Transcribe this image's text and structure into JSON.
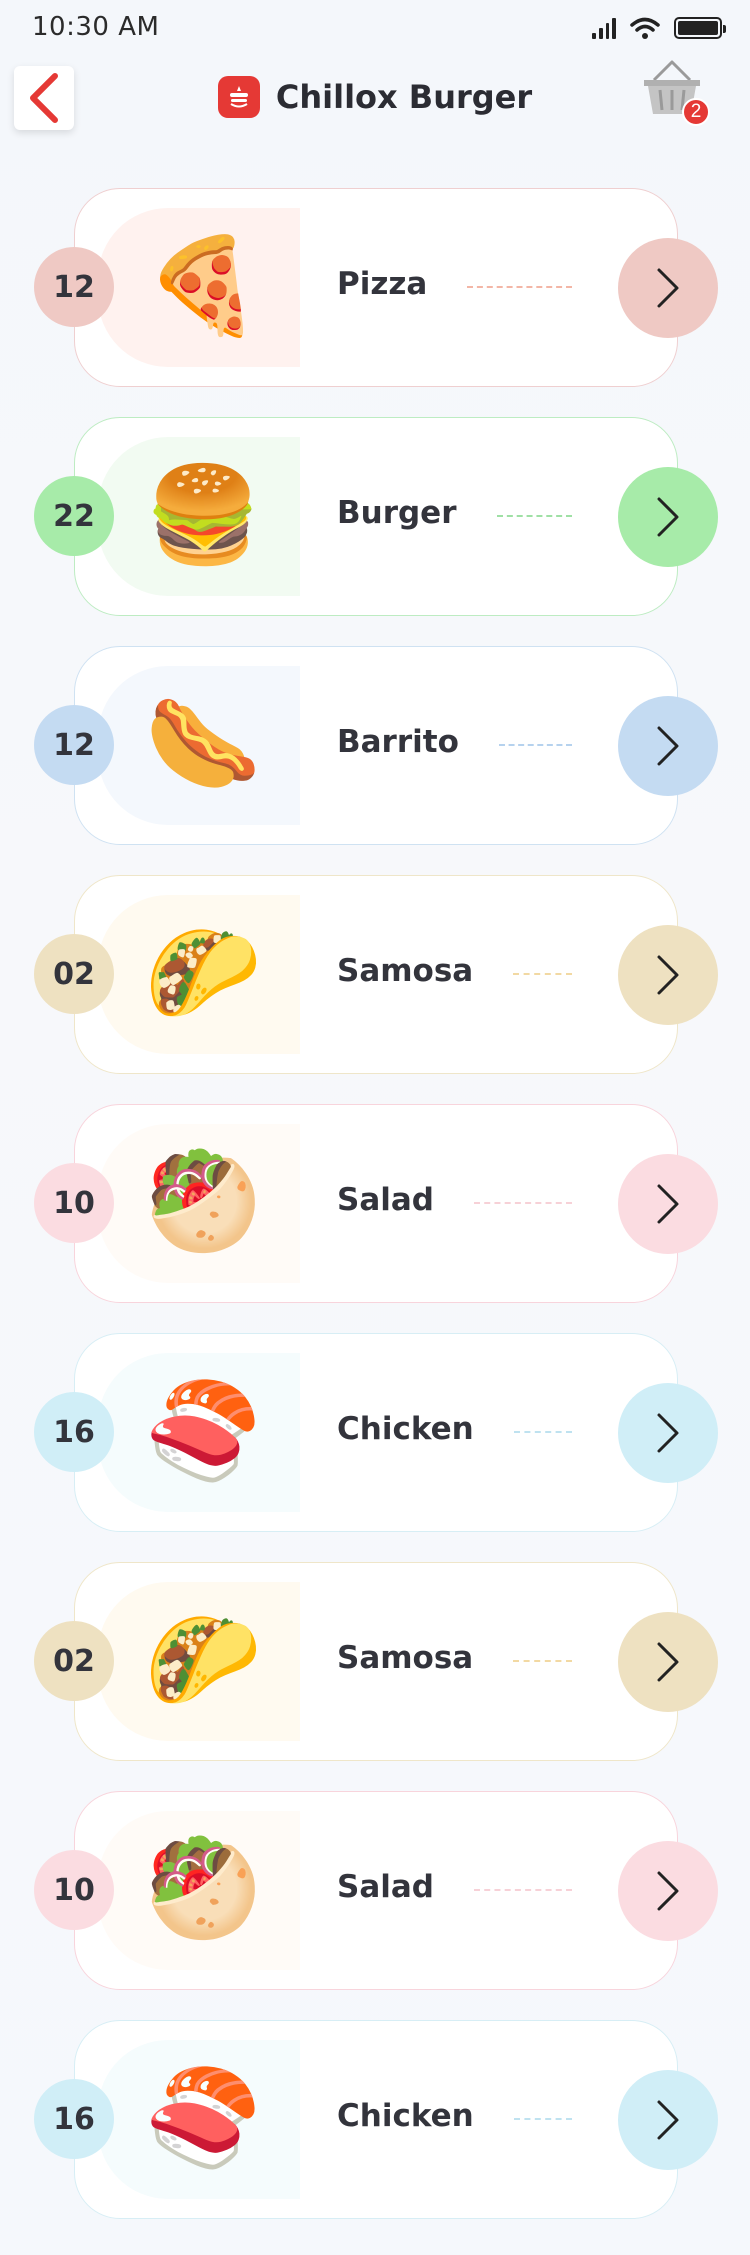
{
  "status_bar": {
    "time": "10:30 AM"
  },
  "header": {
    "title": "Chillox Burger",
    "cart_count": "2",
    "accent": "#e53935"
  },
  "categories": [
    {
      "count": "12",
      "name": "Pizza",
      "icon": "pizza-icon",
      "emoji": "🍕",
      "color": "#efc9c4",
      "tint": "#fff2ef",
      "border": "#efcfd0",
      "dash": "#f3b6a6"
    },
    {
      "count": "22",
      "name": "Burger",
      "icon": "burger-icon",
      "emoji": "🍔",
      "color": "#a7eba9",
      "tint": "#f2fbf2",
      "border": "#bdecc2",
      "dash": "#9fe0a5"
    },
    {
      "count": "12",
      "name": "Barrito",
      "icon": "hotdog-icon",
      "emoji": "🌭",
      "color": "#c4dbf2",
      "tint": "#f4f8fd",
      "border": "#cfe2f2",
      "dash": "#b6d2ee"
    },
    {
      "count": "02",
      "name": "Samosa",
      "icon": "taco-icon",
      "emoji": "🌮",
      "color": "#eee1c1",
      "tint": "#fffaf0",
      "border": "#efe6c9",
      "dash": "#f2d9a3"
    },
    {
      "count": "10",
      "name": "Salad",
      "icon": "pita-icon",
      "emoji": "🥙",
      "color": "#fbdce1",
      "tint": "#fffbf7",
      "border": "#f8d4dc",
      "dash": "#f7d1d7"
    },
    {
      "count": "16",
      "name": "Chicken",
      "icon": "sushi-icon",
      "emoji": "🍣",
      "color": "#d0eef7",
      "tint": "#f5fcfd",
      "border": "#d7eef5",
      "dash": "#bfe2f0"
    },
    {
      "count": "02",
      "name": "Samosa",
      "icon": "taco-icon",
      "emoji": "🌮",
      "color": "#eee1c1",
      "tint": "#fffaf0",
      "border": "#efe6c9",
      "dash": "#f2d9a3"
    },
    {
      "count": "10",
      "name": "Salad",
      "icon": "pita-icon",
      "emoji": "🥙",
      "color": "#fbdce1",
      "tint": "#fffbf7",
      "border": "#f8d4dc",
      "dash": "#f7d1d7"
    },
    {
      "count": "16",
      "name": "Chicken",
      "icon": "sushi-icon",
      "emoji": "🍣",
      "color": "#d0eef7",
      "tint": "#f5fcfd",
      "border": "#d7eef5",
      "dash": "#bfe2f0"
    }
  ]
}
